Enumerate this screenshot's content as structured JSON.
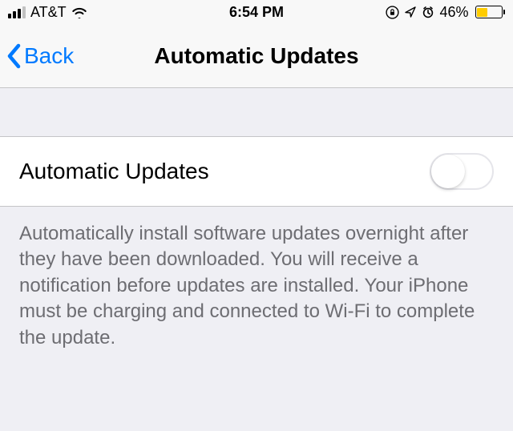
{
  "status": {
    "carrier": "AT&T",
    "time": "6:54 PM",
    "battery_percent": "46%",
    "battery_fill_pct": 46,
    "battery_color": "#ffcc00",
    "low_power_mode": true
  },
  "nav": {
    "back_label": "Back",
    "title": "Automatic Updates"
  },
  "setting": {
    "label": "Automatic Updates",
    "toggle_on": false
  },
  "footer": {
    "text": "Automatically install software updates overnight after they have been downloaded. You will receive a notification before updates are installed. Your iPhone must be charging and connected to Wi-Fi to complete the update."
  }
}
